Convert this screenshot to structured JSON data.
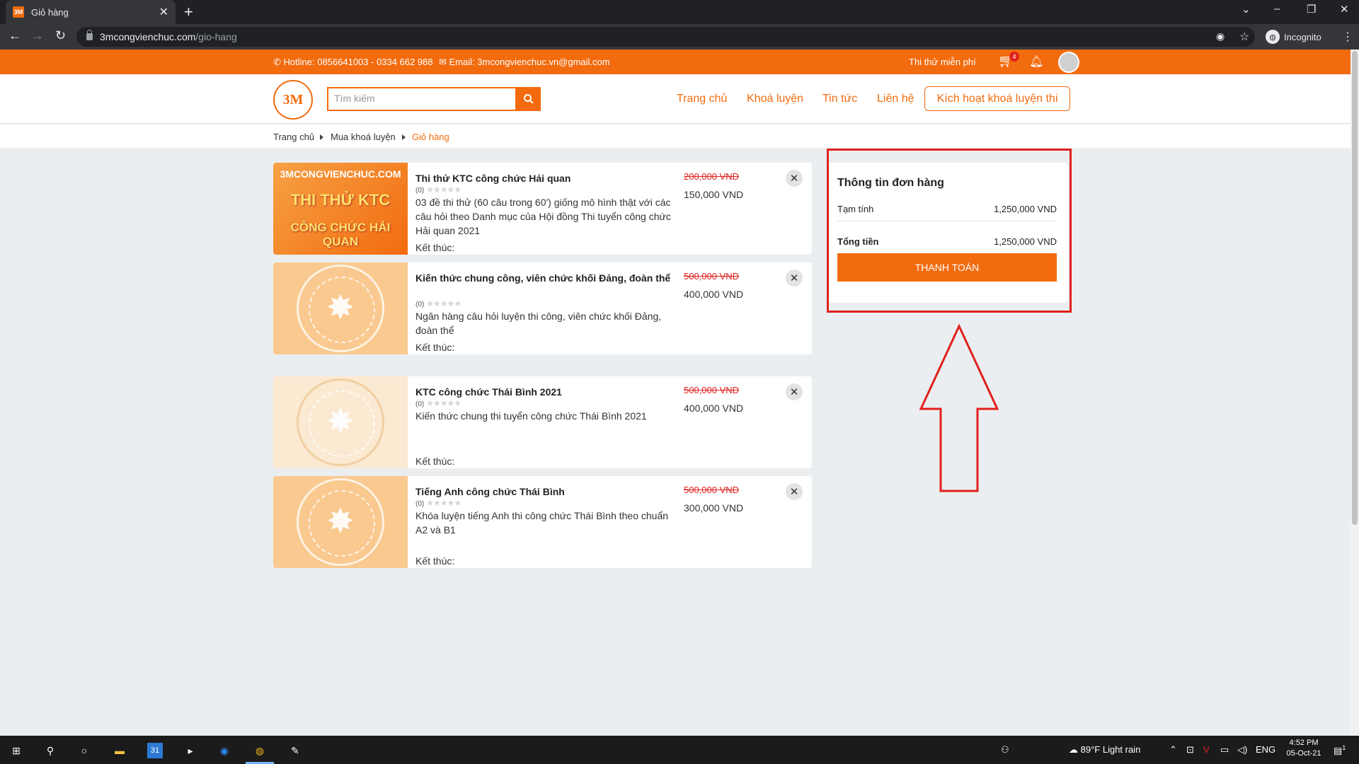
{
  "browser": {
    "tab": {
      "favicon": "3M",
      "title": "Giỏ hàng",
      "close": "✕"
    },
    "new_tab": "+",
    "url_host": "3mcongvienchuc.com",
    "url_path": "/gio-hang",
    "profile_label": "Incognito"
  },
  "topbar": {
    "hotline": "Hotline: 0856641003 - 0334 662 988",
    "email": "Email: 3mcongvienchuc.vn@gmail.com",
    "trial_link": "Thi thử miễn phí",
    "cart_count": "4"
  },
  "header": {
    "logo": "3M",
    "search_placeholder": "Tìm kiếm",
    "nav": [
      "Trang chủ",
      "Khoá luyện",
      "Tin tức",
      "Liên hệ"
    ],
    "activate_button": "Kích hoạt khoá luyện thi"
  },
  "breadcrumb": [
    "Trang chủ",
    "Mua khoá luyện",
    "Giỏ hàng"
  ],
  "cart": {
    "items": [
      {
        "title": "Thi thử KTC công chức Hải quan",
        "rating": "(0)",
        "description": "03 đề thi thử (60 câu trong 60') giống mô hình thật với các câu hỏi theo Danh mục của Hội đồng Thi tuyển công chức Hải quan 2021",
        "end_label": "Kết thúc:",
        "price_old": "200,000 VND",
        "price_new": "150,000 VND",
        "thumb": {
          "line1": "3MCONGVIENCHUC.COM",
          "line2": "THI THỬ KTC",
          "line3": "CÔNG CHỨC HẢI QUAN"
        }
      },
      {
        "title": "Kiến thức chung công, viên chức khối Đảng, đoàn thể",
        "rating": "(0)",
        "description": "Ngân hàng câu hỏi luyện thi công, viên chức khối Đảng, đoàn thể",
        "end_label": "Kết thúc:",
        "price_old": "500,000 VND",
        "price_new": "400,000 VND"
      },
      {
        "title": "KTC công chức Thái Bình 2021",
        "rating": "(0)",
        "description": "Kiến thức chung thi tuyển công chức Thái Bình 2021",
        "end_label": "Kết thúc:",
        "price_old": "500,000 VND",
        "price_new": "400,000 VND"
      },
      {
        "title": "Tiếng Anh công chức Thái Bình",
        "rating": "(0)",
        "description": "Khóa luyện tiếng Anh thi công chức Thái Bình theo chuẩn A2 và B1",
        "end_label": "Kết thúc:",
        "price_old": "500,000 VND",
        "price_new": "300,000 VND"
      }
    ],
    "remove_symbol": "✕"
  },
  "order": {
    "title": "Thông tin đơn hàng",
    "subtotal_label": "Tạm tính",
    "subtotal_value": "1,250,000 VND",
    "total_label": "Tổng tiền",
    "total_value": "1,250,000 VND",
    "pay_button": "THANH TOÁN"
  },
  "annotation": {
    "color": "#e0201d"
  },
  "taskbar": {
    "weather": "89°F  Light rain",
    "lang": "ENG",
    "time": "4:52 PM",
    "date": "05-Oct-21",
    "notif_count": "1"
  },
  "colors": {
    "accent": "#f26b0e",
    "sale": "#e0201d",
    "background": "#ebeef0"
  }
}
